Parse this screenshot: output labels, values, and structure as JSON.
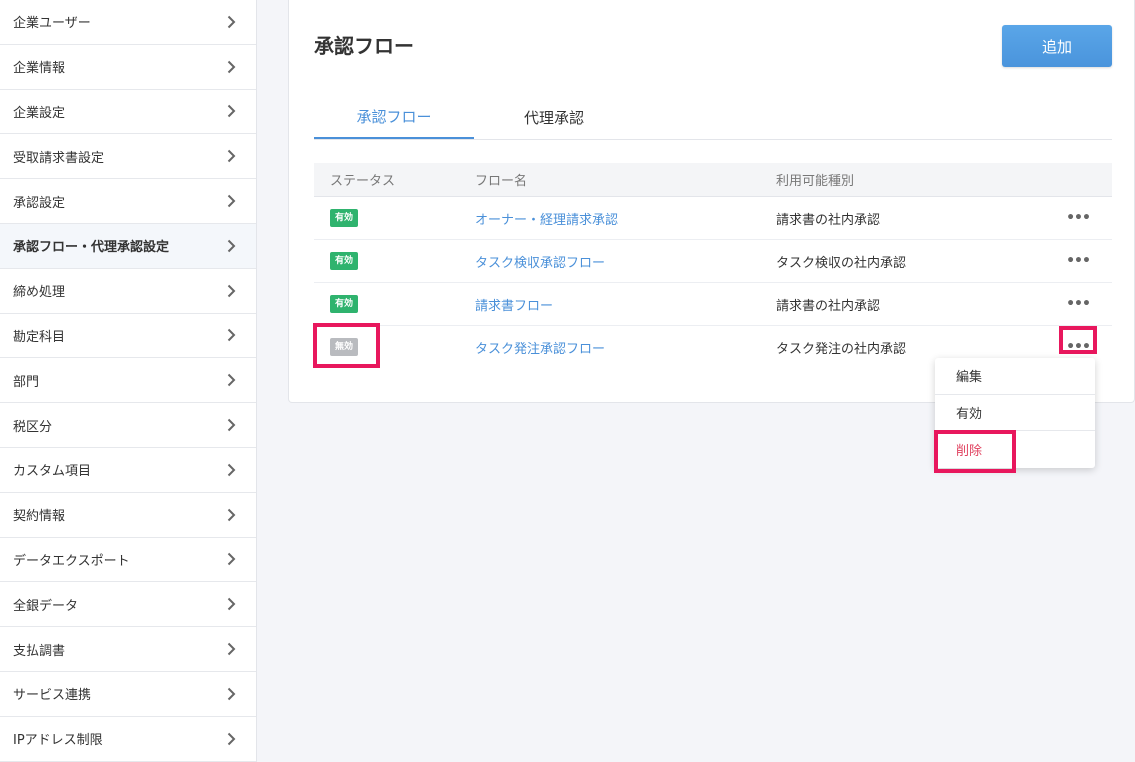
{
  "sidebar": {
    "items": [
      {
        "label": "企業ユーザー"
      },
      {
        "label": "企業情報"
      },
      {
        "label": "企業設定"
      },
      {
        "label": "受取請求書設定"
      },
      {
        "label": "承認設定"
      },
      {
        "label": "承認フロー・代理承認設定",
        "active": true
      },
      {
        "label": "締め処理"
      },
      {
        "label": "勘定科目"
      },
      {
        "label": "部門"
      },
      {
        "label": "税区分"
      },
      {
        "label": "カスタム項目"
      },
      {
        "label": "契約情報"
      },
      {
        "label": "データエクスポート"
      },
      {
        "label": "全銀データ"
      },
      {
        "label": "支払調書"
      },
      {
        "label": "サービス連携"
      },
      {
        "label": "IPアドレス制限"
      }
    ]
  },
  "main": {
    "title": "承認フロー",
    "add_label": "追加",
    "tabs": [
      {
        "label": "承認フロー",
        "active": true
      },
      {
        "label": "代理承認"
      }
    ],
    "table": {
      "headers": [
        "ステータス",
        "フロー名",
        "利用可能種別"
      ],
      "rows": [
        {
          "status": "有効",
          "name": "オーナー・経理請求承認",
          "kind": "請求書の社内承認"
        },
        {
          "status": "有効",
          "name": "タスク検収承認フロー",
          "kind": "タスク検収の社内承認"
        },
        {
          "status": "有効",
          "name": "請求書フロー",
          "kind": "請求書の社内承認"
        },
        {
          "status": "無効",
          "name": "タスク発注承認フロー",
          "kind": "タスク発注の社内承認"
        }
      ]
    },
    "more_icon": "•••",
    "context_menu": {
      "items": [
        {
          "label": "編集"
        },
        {
          "label": "有効"
        },
        {
          "label": "削除"
        }
      ]
    }
  },
  "colors": {
    "accent": "#4a90d9",
    "active_badge": "#2fb36e",
    "inactive_badge": "#b9bbbf",
    "highlight": "#e8175d",
    "danger": "#e0425f"
  }
}
